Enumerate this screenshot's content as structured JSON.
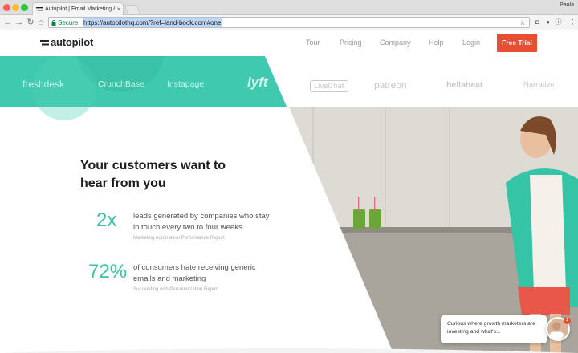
{
  "browser": {
    "tab_title": "Autopilot | Email Marketing & ...",
    "tab_close": "×",
    "user": "Paula",
    "secure_label": "Secure",
    "url": "https://autopilothq.com/?ref=land-book.com#one"
  },
  "header": {
    "logo": "autopilot",
    "nav": [
      "Tour",
      "Pricing",
      "Company",
      "Help",
      "Login"
    ],
    "cta": "Free Trial"
  },
  "logo_band": {
    "teal": [
      "freshdesk",
      "CrunchBase",
      "Instapage",
      "lyft"
    ],
    "grey": [
      "LiveChat",
      "patreon",
      "bellabeat",
      "Narrative"
    ]
  },
  "hero": {
    "headline": "Your customers want to hear from you",
    "stats": [
      {
        "value": "2x",
        "text": "leads generated by companies who stay in touch every two to four weeks",
        "source": "Marketing Automation Performance Report"
      },
      {
        "value": "72%",
        "text": "of consumers hate receiving generic emails and marketing",
        "source": "Succeeding with Personalization Report"
      }
    ]
  },
  "chat": {
    "message": "Curious where growth marketers are investing and what's...",
    "badge": "1"
  },
  "colors": {
    "teal": "#37c2a8",
    "cta": "#e84e33"
  }
}
